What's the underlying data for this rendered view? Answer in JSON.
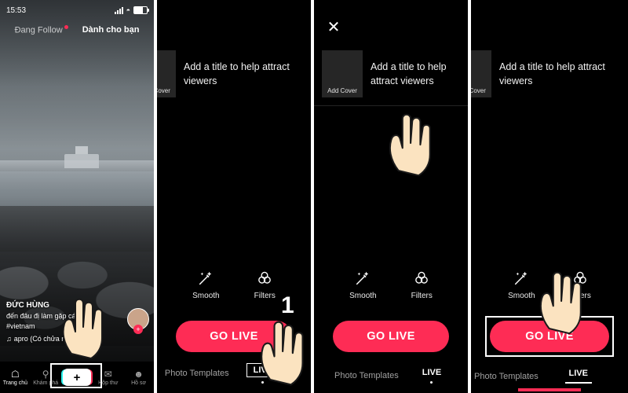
{
  "panels": [
    {
      "id": "feed",
      "status_bar": {
        "time": "15:53"
      },
      "feed_tabs": [
        {
          "label": "Đang Follow",
          "active": false,
          "live_dot": true
        },
        {
          "label": "Dành cho bạn",
          "active": true,
          "live_dot": false
        }
      ],
      "caption": {
        "name": "ĐỨC HÙNG",
        "text": "đến đâu đị làm gặp cái\n#vietnam",
        "music": "apro (Có chửa nhạc"
      },
      "tabbar": [
        {
          "label": "Trang chủ",
          "icon": "home-icon",
          "selected": true
        },
        {
          "label": "Khám phá",
          "icon": "search-icon",
          "selected": false
        },
        {
          "label": "",
          "icon": "plus-icon",
          "selected": false
        },
        {
          "label": "Hộp thư",
          "icon": "inbox-icon",
          "selected": false
        },
        {
          "label": "Hồ sơ",
          "icon": "profile-icon",
          "selected": false
        }
      ],
      "plus_button_label": "+"
    },
    {
      "id": "live-composer-a",
      "cover_label": "Add Cover",
      "title_hint": "Add a title to help attract viewers",
      "tools": [
        {
          "label": "Smooth",
          "icon": "magic-wand-icon"
        },
        {
          "label": "Filters",
          "icon": "filters-circles-icon"
        }
      ],
      "go_live_label": "GO LIVE",
      "modes": [
        {
          "label": "Photo Templates",
          "selected": false
        },
        {
          "label": "LIVE",
          "selected": true
        }
      ]
    },
    {
      "id": "live-composer-b",
      "close_icon": "close-icon",
      "cover_label": "Add Cover",
      "title_hint": "Add a title to help attract viewers",
      "tools": [
        {
          "label": "Smooth",
          "icon": "magic-wand-icon"
        },
        {
          "label": "Filters",
          "icon": "filters-circles-icon"
        }
      ],
      "go_live_label": "GO LIVE",
      "modes": [
        {
          "label": "Photo Templates",
          "selected": false
        },
        {
          "label": "LIVE",
          "selected": true
        }
      ],
      "step_number": "1"
    },
    {
      "id": "live-composer-c",
      "cover_label": "Add Cover",
      "title_hint": "Add a title to help attract viewers",
      "tools": [
        {
          "label": "Smooth",
          "icon": "magic-wand-icon"
        },
        {
          "label": "Filters",
          "icon": "filters-circles-icon"
        }
      ],
      "go_live_label": "GO LIVE",
      "modes": [
        {
          "label": "Photo Templates",
          "selected": false
        },
        {
          "label": "LIVE",
          "selected": true
        }
      ]
    }
  ],
  "colors": {
    "accent": "#fe2c55",
    "background": "#000000",
    "gap": "#ffffff",
    "hand_fill": "#fbe3c0",
    "hand_stroke": "#1a1a1a"
  }
}
